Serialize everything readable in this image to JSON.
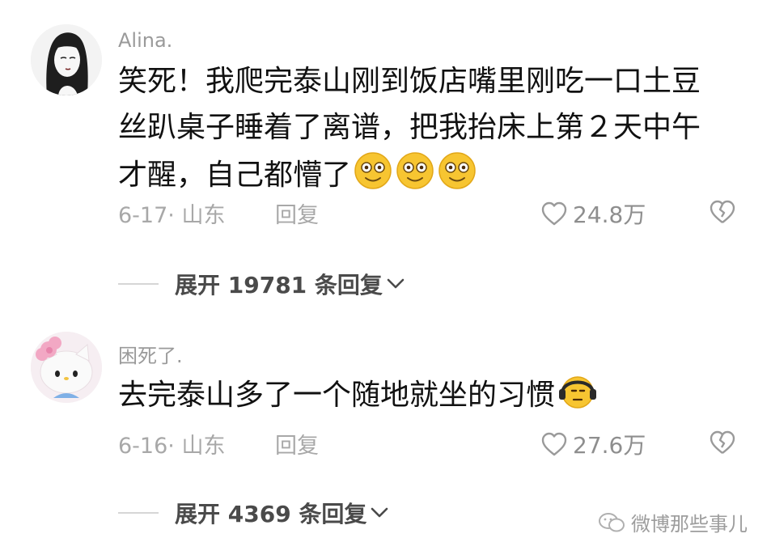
{
  "comments": [
    {
      "username": "Alina.",
      "text_lines": [
        "笑死！我爬完泰山刚到饭店嘴里刚吃一口土豆",
        "丝趴桌子睡着了离谱，把我抬床上第２天中午",
        "才醒，自己都懵了"
      ],
      "emojis": [
        "flushed-smile",
        "flushed-smile",
        "flushed-smile"
      ],
      "date_location": "6-17· 山东",
      "reply_label": "回复",
      "likes": "24.8万",
      "expand_label": "展开 19781 条回复"
    },
    {
      "username": "困死了.",
      "text_lines": [
        "去完泰山多了一个随地就坐的习惯"
      ],
      "emojis": [
        "headphones-face"
      ],
      "date_location": "6-16· 山东",
      "reply_label": "回复",
      "likes": "27.6万",
      "expand_label": "展开 4369 条回复"
    }
  ],
  "watermark": "微博那些事儿",
  "colors": {
    "text": "#111111",
    "meta": "#a8a8a8",
    "username": "#9a9a9a",
    "emoji_yellow": "#f7c531"
  }
}
